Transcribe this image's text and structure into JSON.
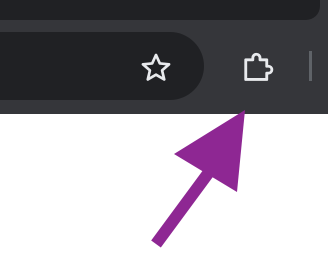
{
  "browser": {
    "theme": "dark",
    "toolbar_color": "#35363a",
    "omnibox_color": "#202124",
    "icon_color": "#e8eaed"
  },
  "toolbar": {
    "bookmark_star": {
      "icon": "star-outline-icon"
    },
    "extensions": {
      "icon": "puzzle-piece-icon"
    }
  },
  "annotation": {
    "arrow_color": "#8e2793",
    "points_to": "extensions-button"
  }
}
